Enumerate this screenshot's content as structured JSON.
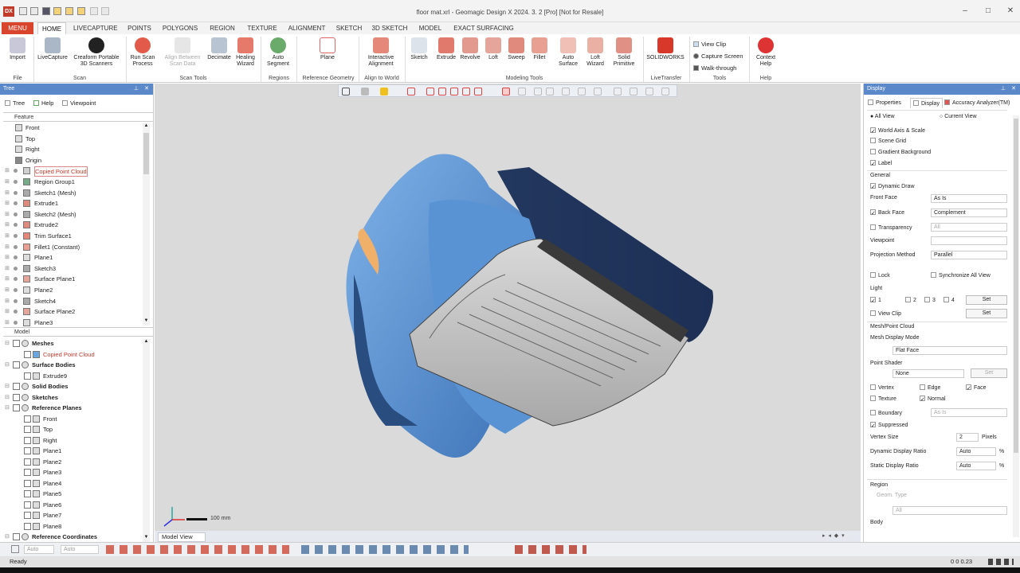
{
  "window": {
    "title": "floor mat.xrl - Geomagic Design X 2024. 3. 2 [Pro] [Not for Resale]",
    "logo": "DX"
  },
  "ribbon_tabs": [
    "MENU",
    "HOME",
    "LIVECAPTURE",
    "POINTS",
    "POLYGONS",
    "REGION",
    "TEXTURE",
    "ALIGNMENT",
    "SKETCH",
    "3D SKETCH",
    "MODEL",
    "EXACT SURFACING"
  ],
  "ribbon": {
    "import": "Import",
    "livecapture": "LiveCapture",
    "creaform1": "Creaform Portable",
    "creaform2": "3D Scanners",
    "runscan1": "Run Scan",
    "runscan2": "Process",
    "align1": "Align Between",
    "align2": "Scan Data",
    "decimate": "Decimate",
    "healing1": "Healing",
    "healing2": "Wizard",
    "autoseg1": "Auto",
    "autoseg2": "Segment",
    "plane": "Plane",
    "interactive1": "Interactive",
    "interactive2": "Alignment",
    "sketch": "Sketch",
    "extrude": "Extrude",
    "revolve": "Revolve",
    "loft": "Loft",
    "sweep": "Sweep",
    "fillet": "Fillet",
    "autosurf1": "Auto",
    "autosurf2": "Surface",
    "loftwiz1": "Loft",
    "loftwiz2": "Wizard",
    "solidprim1": "Solid",
    "solidprim2": "Primitive",
    "solidworks": "SOLIDWORKS",
    "viewclip": "View Clip",
    "capture": "Capture Screen",
    "walk": "Walk-through",
    "context1": "Context",
    "context2": "Help",
    "groups": {
      "file": "File",
      "scan": "Scan",
      "scantools": "Scan Tools",
      "regions": "Regions",
      "refgeo": "Reference Geometry",
      "align": "Align to World",
      "modeling": "Modeling Tools",
      "livetransfer": "LiveTransfer",
      "tools": "Tools",
      "help": "Help"
    }
  },
  "left": {
    "title": "Tree",
    "tabs": [
      "Tree",
      "Help",
      "Viewpoint"
    ],
    "feature_label": "Feature",
    "features": [
      "Front",
      "Top",
      "Right",
      "Origin",
      "Copied Point Cloud",
      "Region Group1",
      "Sketch1 (Mesh)",
      "Extrude1",
      "Sketch2 (Mesh)",
      "Extrude2",
      "Trim Surface1",
      "Fillet1 (Constant)",
      "Plane1",
      "Sketch3",
      "Surface Plane1",
      "Plane2",
      "Sketch4",
      "Surface Plane2",
      "Plane3"
    ],
    "model_label": "Model",
    "model": [
      {
        "t": "Meshes",
        "d": 0,
        "b": true
      },
      {
        "t": "Copied Point Cloud",
        "d": 1,
        "b": false,
        "red": true
      },
      {
        "t": "Surface Bodies",
        "d": 0,
        "b": true
      },
      {
        "t": "Extrude9",
        "d": 1,
        "b": false
      },
      {
        "t": "Solid Bodies",
        "d": 0,
        "b": true
      },
      {
        "t": "Sketches",
        "d": 0,
        "b": true
      },
      {
        "t": "Reference Planes",
        "d": 0,
        "b": true
      },
      {
        "t": "Front",
        "d": 1,
        "b": false
      },
      {
        "t": "Top",
        "d": 1,
        "b": false
      },
      {
        "t": "Right",
        "d": 1,
        "b": false
      },
      {
        "t": "Plane1",
        "d": 1,
        "b": false
      },
      {
        "t": "Plane2",
        "d": 1,
        "b": false
      },
      {
        "t": "Plane3",
        "d": 1,
        "b": false
      },
      {
        "t": "Plane4",
        "d": 1,
        "b": false
      },
      {
        "t": "Plane5",
        "d": 1,
        "b": false
      },
      {
        "t": "Plane6",
        "d": 1,
        "b": false
      },
      {
        "t": "Plane7",
        "d": 1,
        "b": false
      },
      {
        "t": "Plane8",
        "d": 1,
        "b": false
      },
      {
        "t": "Reference Coordinates",
        "d": 0,
        "b": true
      }
    ]
  },
  "viewport": {
    "scale": "100 mm",
    "tab": "Model View"
  },
  "bottom": {
    "auto1": "Auto",
    "auto2": "Auto"
  },
  "status": {
    "text": "Ready",
    "coords": "0  0  0.23"
  },
  "right": {
    "title": "Display",
    "tabs": [
      "Properties",
      "Display",
      "Accuracy Analyzer(TM)"
    ],
    "allview": "All View",
    "currentview": "Current View",
    "worldaxis": "World Axis & Scale",
    "scenegrid": "Scene Grid",
    "gradient": "Gradient Background",
    "label": "Label",
    "general": "General",
    "dynamic": "Dynamic Draw",
    "frontface": "Front Face",
    "frontface_val": "As Is",
    "backface": "Back Face",
    "backface_val": "Complement",
    "transparency": "Transparency",
    "transparency_val": "All",
    "viewpoint": "Viewpoint",
    "projection": "Projection Method",
    "projection_val": "Parallel",
    "lock": "Lock",
    "sync": "Synchronize All View",
    "light": "Light",
    "l1": "1",
    "l2": "2",
    "l3": "3",
    "l4": "4",
    "set": "Set",
    "viewclip": "View Clip",
    "meshpc": "Mesh/Point Cloud",
    "meshmode": "Mesh Display Mode",
    "meshmode_val": "Flat Face",
    "pointshader": "Point Shader",
    "pointshader_val": "None",
    "set_dis": "Set",
    "vertex": "Vertex",
    "edge": "Edge",
    "face": "Face",
    "texture": "Texture",
    "normal": "Normal",
    "boundary": "Boundary",
    "boundary_val": "As Is",
    "suppressed": "Suppressed",
    "vertexsize": "Vertex Size",
    "vertexsize_val": "2",
    "pixels": "Pixels",
    "dynratio": "Dynamic Display Ratio",
    "dynratio_val": "Auto",
    "pct": "%",
    "staticratio": "Static Display Ratio",
    "staticratio_val": "Auto",
    "region": "Region",
    "geomtype": "Geom. Type",
    "geomtype_val": "All",
    "body": "Body"
  }
}
